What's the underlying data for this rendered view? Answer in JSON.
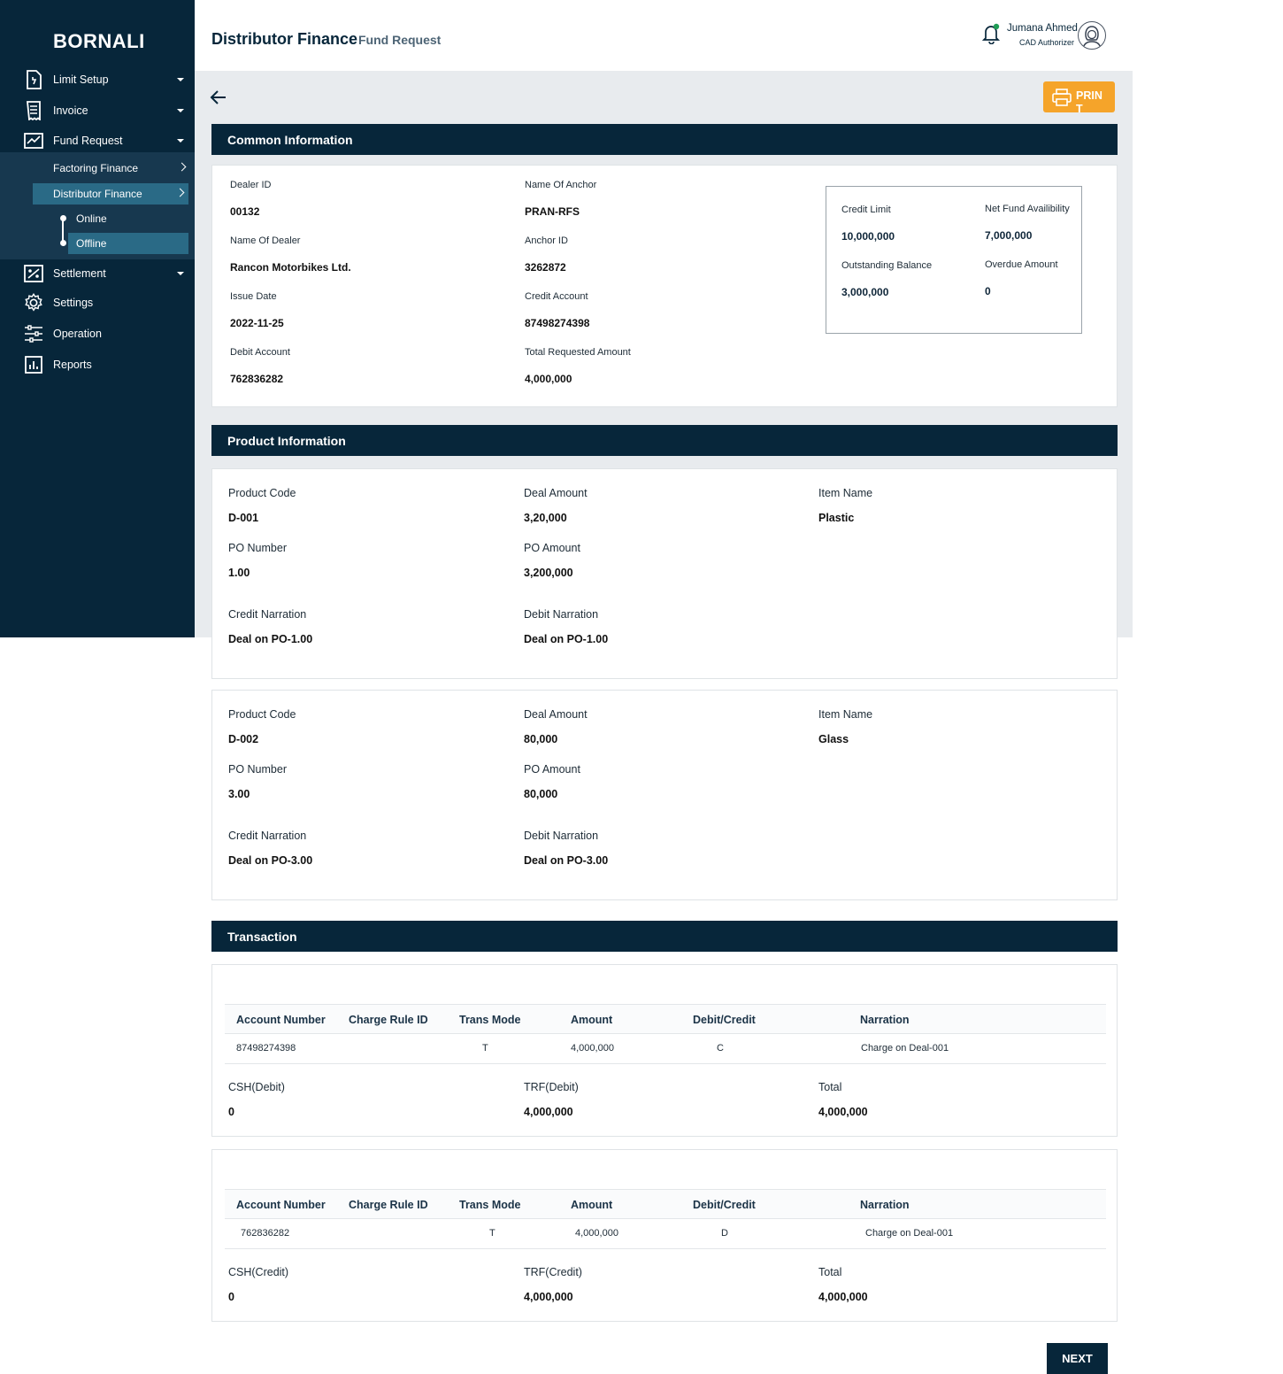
{
  "brand": "BORNALI",
  "sidebar": {
    "items": [
      {
        "label": "Limit Setup",
        "icon": "document-icon"
      },
      {
        "label": "Invoice",
        "icon": "receipt-icon"
      },
      {
        "label": "Fund Request",
        "icon": "chart-line-icon"
      },
      {
        "label": "Settlement",
        "icon": "percent-icon"
      },
      {
        "label": "Settings",
        "icon": "gear-icon"
      },
      {
        "label": "Operation",
        "icon": "sliders-icon"
      },
      {
        "label": "Reports",
        "icon": "bar-chart-icon"
      }
    ],
    "sub_items": [
      "Factoring Finance",
      "Distributor Finance"
    ],
    "sub_sub_items": [
      "Online",
      "Offline"
    ]
  },
  "header": {
    "title": "Distributor Finance",
    "subtitle": "Fund Request",
    "user_name": "Jumana Ahmed",
    "user_role": "CAD Authorizer"
  },
  "print_label": "PRIN T",
  "common": {
    "title": "Common Information",
    "fields": [
      {
        "label": "Dealer ID",
        "value": "00132"
      },
      {
        "label": "Name Of Anchor",
        "value": "PRAN-RFS"
      },
      {
        "label": "Name Of Dealer",
        "value": "Rancon Motorbikes Ltd."
      },
      {
        "label": "Anchor ID",
        "value": "3262872"
      },
      {
        "label": "Issue Date",
        "value": "2022-11-25"
      },
      {
        "label": "Credit Account",
        "value": "87498274398"
      },
      {
        "label": "Debit Account",
        "value": "762836282"
      },
      {
        "label": "Total Requested Amount",
        "value": "4,000,000"
      }
    ],
    "limits": [
      {
        "label": "Credit Limit",
        "value": "10,000,000"
      },
      {
        "label": "Net Fund Availibility",
        "value": "7,000,000"
      },
      {
        "label": "Outstanding Balance",
        "value": "3,000,000"
      },
      {
        "label": "Overdue Amount",
        "value": "0"
      }
    ]
  },
  "product": {
    "title": "Product Information",
    "labels": {
      "product_code": "Product Code",
      "deal_amount": "Deal Amount",
      "item_name": "Item Name",
      "po_number": "PO Number",
      "po_amount": "PO Amount",
      "credit_narration": "Credit Narration",
      "debit_narration": "Debit Narration"
    },
    "items": [
      {
        "product_code": "D-001",
        "deal_amount": "3,20,000",
        "item_name": "Plastic",
        "po_number": "1.00",
        "po_amount": "3,200,000",
        "credit_narration": "Deal on PO-1.00",
        "debit_narration": "Deal on PO-1.00"
      },
      {
        "product_code": "D-002",
        "deal_amount": "80,000",
        "item_name": "Glass",
        "po_number": "3.00",
        "po_amount": "80,000",
        "credit_narration": "Deal on PO-3.00",
        "debit_narration": "Deal on PO-3.00"
      }
    ]
  },
  "transaction": {
    "title": "Transaction",
    "columns": [
      "Account Number",
      "Charge Rule ID",
      "Trans Mode",
      "Amount",
      "Debit/Credit",
      "Narration"
    ],
    "blocks": [
      {
        "row": {
          "account": "87498274398",
          "charge_rule": "",
          "mode": "T",
          "amount": "4,000,000",
          "dc": "C",
          "narration": "Charge on Deal-001"
        },
        "summary": [
          {
            "label": "CSH(Debit)",
            "value": "0"
          },
          {
            "label": "TRF(Debit)",
            "value": "4,000,000"
          },
          {
            "label": "Total",
            "value": "4,000,000"
          }
        ]
      },
      {
        "row": {
          "account": "762836282",
          "charge_rule": "",
          "mode": "T",
          "amount": "4,000,000",
          "dc": "D",
          "narration": "Charge on Deal-001"
        },
        "summary": [
          {
            "label": "CSH(Credit)",
            "value": "0"
          },
          {
            "label": "TRF(Credit)",
            "value": "4,000,000"
          },
          {
            "label": "Total",
            "value": "4,000,000"
          }
        ]
      }
    ]
  },
  "next_label": "NEXT",
  "colors": {
    "sidebar": "#07263a",
    "accent": "#f5a42a",
    "active": "#2a6a86"
  }
}
